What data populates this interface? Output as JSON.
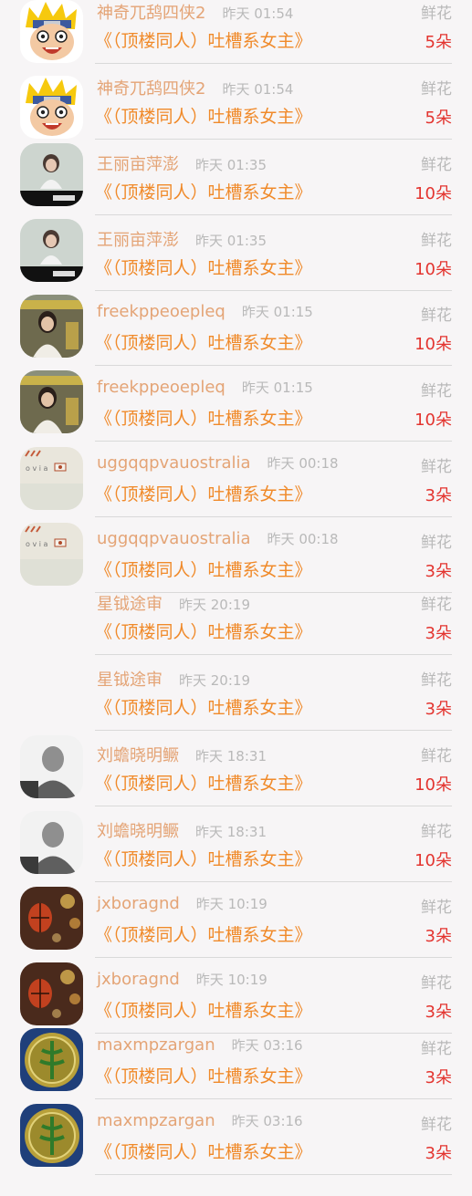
{
  "gifts": [
    {
      "user": "神奇兀鸹四侠2",
      "time": "昨天 01:54",
      "type": "鲜花",
      "book": "《（顶楼同人）吐槽系女主》",
      "amount": "5朵",
      "avatar": "naruto-avatar-icon"
    },
    {
      "user": "神奇兀鸹四侠2",
      "time": "昨天 01:54",
      "type": "鲜花",
      "book": "《（顶楼同人）吐槽系女主》",
      "amount": "5朵",
      "avatar": "naruto-avatar-icon"
    },
    {
      "user": "王丽亩萍澎",
      "time": "昨天 01:35",
      "type": "鲜花",
      "book": "《（顶楼同人）吐槽系女主》",
      "amount": "10朵",
      "avatar": "girl-photo-avatar-icon"
    },
    {
      "user": "王丽亩萍澎",
      "time": "昨天 01:35",
      "type": "鲜花",
      "book": "《（顶楼同人）吐槽系女主》",
      "amount": "10朵",
      "avatar": "girl-photo-avatar-icon"
    },
    {
      "user": "freekppeoepleq",
      "time": "昨天 01:15",
      "type": "鲜花",
      "book": "《（顶楼同人）吐槽系女主》",
      "amount": "10朵",
      "avatar": "woman-in-car-avatar-icon"
    },
    {
      "user": "freekppeoepleq",
      "time": "昨天 01:15",
      "type": "鲜花",
      "book": "《（顶楼同人）吐槽系女主》",
      "amount": "10朵",
      "avatar": "woman-in-car-avatar-icon"
    },
    {
      "user": "uggqqpvauostralia",
      "time": "昨天 00:18",
      "type": "鲜花",
      "book": "《（顶楼同人）吐槽系女主》",
      "amount": "3朵",
      "avatar": "sketch-avatar-icon"
    },
    {
      "user": "uggqqpvauostralia",
      "time": "昨天 00:18",
      "type": "鲜花",
      "book": "《（顶楼同人）吐槽系女主》",
      "amount": "3朵",
      "avatar": "sketch-avatar-icon"
    },
    {
      "user": "星钺途审",
      "time": "昨天 20:19",
      "type": "鲜花",
      "book": "《（顶楼同人）吐槽系女主》",
      "amount": "3朵",
      "avatar": ""
    },
    {
      "user": "星钺途审",
      "time": "昨天 20:19",
      "type": "鲜花",
      "book": "《（顶楼同人）吐槽系女主》",
      "amount": "3朵",
      "avatar": ""
    },
    {
      "user": "刘蟾晓明鳜",
      "time": "昨天 18:31",
      "type": "鲜花",
      "book": "《（顶楼同人）吐槽系女主》",
      "amount": "10朵",
      "avatar": "grey-silhouette-avatar-icon"
    },
    {
      "user": "刘蟾晓明鳜",
      "time": "昨天 18:31",
      "type": "鲜花",
      "book": "《（顶楼同人）吐槽系女主》",
      "amount": "10朵",
      "avatar": "grey-silhouette-avatar-icon"
    },
    {
      "user": "jxboragnd",
      "time": "昨天 10:19",
      "type": "鲜花",
      "book": "《（顶楼同人）吐槽系女主》",
      "amount": "3朵",
      "avatar": "lanterns-avatar-icon"
    },
    {
      "user": "jxboragnd",
      "time": "昨天 10:19",
      "type": "鲜花",
      "book": "《（顶楼同人）吐槽系女主》",
      "amount": "3朵",
      "avatar": "lanterns-avatar-icon"
    },
    {
      "user": "maxmpzargan",
      "time": "昨天 03:16",
      "type": "鲜花",
      "book": "《（顶楼同人）吐槽系女主》",
      "amount": "3朵",
      "avatar": "gold-coin-avatar-icon"
    },
    {
      "user": "maxmpzargan",
      "time": "昨天 03:16",
      "type": "鲜花",
      "book": "《（顶楼同人）吐槽系女主》",
      "amount": "3朵",
      "avatar": "gold-coin-avatar-icon"
    }
  ]
}
